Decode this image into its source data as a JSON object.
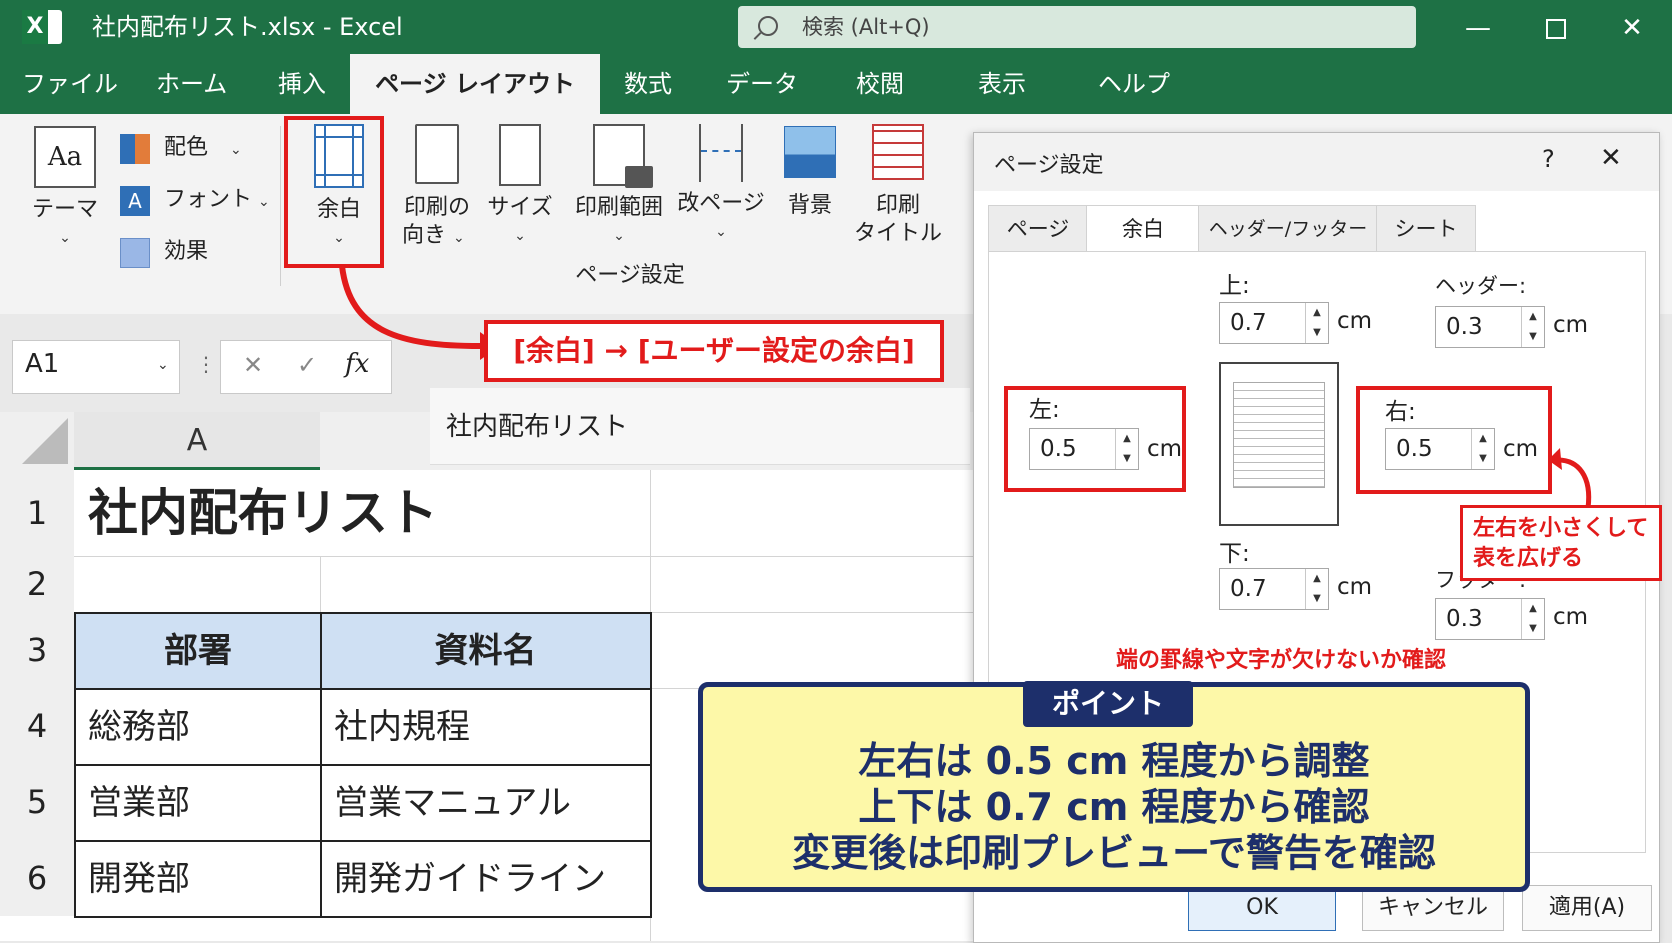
{
  "app": {
    "window_title": "社内配布リスト.xlsx  -  Excel",
    "search_placeholder": "検索 (Alt+Q)",
    "logo_letter": "X"
  },
  "tabs": [
    "ファイル",
    "ホーム",
    "挿入",
    "ページ レイアウト",
    "数式",
    "データ",
    "校閲",
    "表示",
    "ヘルプ"
  ],
  "active_tab": "ページ レイアウト",
  "ribbon": {
    "theme_label": "テーマ",
    "theme_icon_text": "Aa",
    "colors_label": "配色",
    "fonts_label": "フォント",
    "fonts_icon_text": "A",
    "effects_label": "効果",
    "margins_label": "余白",
    "orientation_label_1": "印刷の",
    "orientation_label_2": "向き",
    "size_label": "サイズ",
    "print_area_label": "印刷範囲",
    "breaks_label": "改ページ",
    "background_label": "背景",
    "print_titles_label_1": "印刷",
    "print_titles_label_2": "タイトル",
    "group_label": "ページ設定"
  },
  "formula_bar": {
    "name_box": "A1",
    "fx": "fx",
    "cancel": "✕",
    "enter": "✓",
    "content": "社内配布リスト"
  },
  "sheet": {
    "column_header": "A",
    "row_numbers": [
      "1",
      "2",
      "3",
      "4",
      "5",
      "6"
    ],
    "title": "社内配布リスト",
    "headers": [
      "部署",
      "資料名"
    ],
    "rows": [
      [
        "総務部",
        "社内規程"
      ],
      [
        "営業部",
        "営業マニュアル"
      ],
      [
        "開発部",
        "開発ガイドライン"
      ]
    ]
  },
  "dialog": {
    "title": "ページ設定",
    "help": "?",
    "close": "✕",
    "tabs": [
      "ページ",
      "余白",
      "ヘッダー/フッター",
      "シート"
    ],
    "active_tab": "余白",
    "top_label": "上:",
    "top_value": "0.7",
    "header_label": "ヘッダー:",
    "header_value": "0.3",
    "left_label": "左:",
    "left_value": "0.5",
    "right_label": "右:",
    "right_value": "0.5",
    "bottom_label": "下:",
    "bottom_value": "0.7",
    "footer_label": "フッター:",
    "footer_value": "0.3",
    "unit": "cm",
    "ok": "OK",
    "cancel": "キャンセル",
    "apply": "適用(A)"
  },
  "annotations": {
    "margin_callout": "[余白] → [ユーザー設定の余白]",
    "lr_callout_1": "左右を小さくして",
    "lr_callout_2": "表を広げる",
    "edge_note": "端の罫線や文字が欠けないか確認",
    "point_badge": "ポイント",
    "point_lines": [
      "左右は 0.5 cm 程度から調整",
      "上下は 0.7 cm 程度から確認",
      "変更後は印刷プレビューで警告を確認"
    ]
  },
  "colors": {
    "excel_green": "#1e7145",
    "header_fill": "#cfe0f3",
    "annotation_red": "#e21b1b",
    "point_navy": "#1d2f6b",
    "point_yellow": "#fdf8a8"
  }
}
